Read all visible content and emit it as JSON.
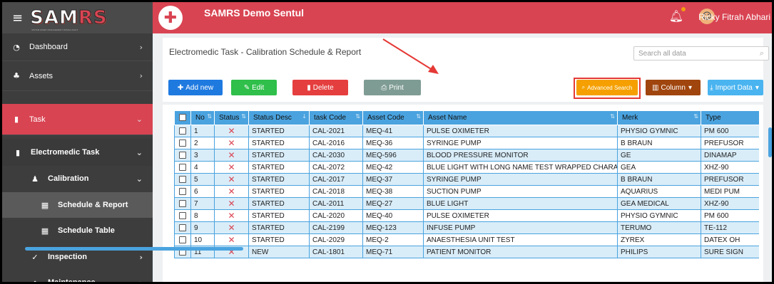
{
  "app": {
    "logo": "SAMRS",
    "logo_subtitle": "SISTEM ASSET MANAGEMENT RUMAH SAKIT",
    "title": "SAMRS Demo Sentul"
  },
  "user": {
    "name": "Ricky Fitrah Abhari"
  },
  "sidebar": {
    "items": [
      {
        "label": "Dashboard",
        "icon": "dashboard-icon"
      },
      {
        "label": "Assets",
        "icon": "assets-icon"
      },
      {
        "label": "Task",
        "icon": "task-icon"
      },
      {
        "label": "Electromedic Task",
        "icon": "book-icon"
      },
      {
        "label": "Calibration",
        "icon": "calibration-icon"
      },
      {
        "label": "Schedule & Report",
        "icon": "calendar-check-icon"
      },
      {
        "label": "Schedule Table",
        "icon": "calendar-icon"
      },
      {
        "label": "Inspection",
        "icon": "check-icon"
      },
      {
        "label": "Maintenance",
        "icon": "maintenance-icon"
      }
    ]
  },
  "page": {
    "title": "Electromedic Task - Calibration Schedule & Report"
  },
  "search": {
    "placeholder": "Search all data"
  },
  "toolbar": {
    "add_label": "Add new",
    "edit_label": "Edit",
    "delete_label": "Delete",
    "print_label": "Print",
    "advanced_label": "Advanced Search",
    "column_label": "Column",
    "import_label": "Import Data"
  },
  "colors": {
    "brand": "#d94452",
    "header": "#4aa3df",
    "row_alt": "#d9edf9",
    "add": "#1f7ae0",
    "edit": "#2fbf4a",
    "delete": "#e53e3e",
    "print": "#7f9c94",
    "advanced": "#f5a000",
    "column": "#a0450e",
    "import": "#4ab4f0"
  },
  "table": {
    "columns": [
      "No",
      "Status",
      "Status Desc",
      "task Code",
      "Asset Code",
      "Asset Name",
      "Merk",
      "Type"
    ],
    "rows": [
      [
        "1",
        "✕",
        "STARTED",
        "CAL-2021",
        "MEQ-41",
        "PULSE OXIMETER",
        "PHYSIO GYMNIC",
        "PM 600"
      ],
      [
        "2",
        "✕",
        "STARTED",
        "CAL-2016",
        "MEQ-36",
        "SYRINGE PUMP",
        "B BRAUN",
        "PREFUSOR"
      ],
      [
        "3",
        "✕",
        "STARTED",
        "CAL-2030",
        "MEQ-596",
        "BLOOD PRESSURE MONITOR",
        "GE",
        "DINAMAP"
      ],
      [
        "4",
        "✕",
        "STARTED",
        "CAL-2072",
        "MEQ-42",
        "BLUE LIGHT WITH LONG NAME TEST WRAPPED CHARACTER",
        "GEA",
        "XHZ-90"
      ],
      [
        "5",
        "✕",
        "STARTED",
        "CAL-2017",
        "MEQ-37",
        "SYRINGE PUMP",
        "B BRAUN",
        "PREFUSOR"
      ],
      [
        "6",
        "✕",
        "STARTED",
        "CAL-2018",
        "MEQ-38",
        "SUCTION PUMP",
        "AQUARIUS",
        "MEDI PUM"
      ],
      [
        "7",
        "✕",
        "STARTED",
        "CAL-2011",
        "MEQ-27",
        "BLUE LIGHT",
        "GEA MEDICAL",
        "XHZ-90"
      ],
      [
        "8",
        "✕",
        "STARTED",
        "CAL-2020",
        "MEQ-40",
        "PULSE OXIMETER",
        "PHYSIO GYMNIC",
        "PM 600"
      ],
      [
        "9",
        "✕",
        "STARTED",
        "CAL-2199",
        "MEQ-123",
        "INFUSE PUMP",
        "TERUMO",
        "TE-112"
      ],
      [
        "10",
        "✕",
        "STARTED",
        "CAL-2029",
        "MEQ-2",
        "ANAESTHESIA UNIT TEST",
        "ZYREX",
        "DATEX OH"
      ],
      [
        "11",
        "✕",
        "NEW",
        "CAL-1801",
        "MEQ-71",
        "PATIENT MONITOR",
        "PHILIPS",
        "SURE SIGN"
      ]
    ]
  }
}
